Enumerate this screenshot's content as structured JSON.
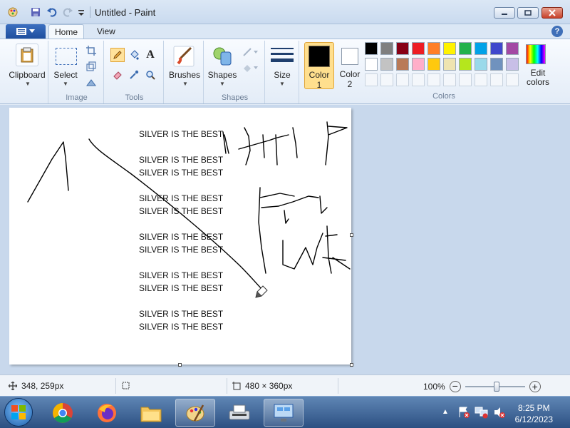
{
  "window": {
    "title": "Untitled - Paint"
  },
  "tabs": [
    {
      "label": "Home",
      "active": true
    },
    {
      "label": "View",
      "active": false
    }
  ],
  "ribbon": {
    "clipboard": {
      "label": "Clipboard"
    },
    "image": {
      "group_label": "Image",
      "select_label": "Select"
    },
    "tools": {
      "group_label": "Tools"
    },
    "brushes": {
      "label": "Brushes"
    },
    "shapes": {
      "label": "Shapes",
      "group_label": "Shapes"
    },
    "size": {
      "label": "Size"
    },
    "color1": {
      "label": "Color",
      "num": "1",
      "value": "#000000"
    },
    "color2": {
      "label": "Color",
      "num": "2",
      "value": "#ffffff"
    },
    "colors_group_label": "Colors",
    "edit_colors_label": "Edit colors",
    "palette_row1": [
      "#000000",
      "#7f7f7f",
      "#880015",
      "#ed1c24",
      "#ff7f27",
      "#fff200",
      "#22b14c",
      "#00a2e8",
      "#3f48cc",
      "#a349a4"
    ],
    "palette_row2": [
      "#ffffff",
      "#c3c3c3",
      "#b97a57",
      "#ffaec9",
      "#ffc90e",
      "#efe4b0",
      "#b5e61d",
      "#99d9ea",
      "#7092be",
      "#c8bfe7"
    ]
  },
  "canvas": {
    "lines": [
      "SILVER IS THE BEST",
      "SILVER IS THE BEST",
      "SILVER IS THE BEST",
      "SILVER IS THE BEST",
      "SILVER IS THE BEST",
      "SILVER IS THE BEST",
      "SILVER IS THE BEST",
      "SILVER IS THE BEST",
      "SILVER IS THE BEST",
      "SILVER IS THE BEST",
      "SILVER IS THE BEST"
    ]
  },
  "status": {
    "cursor_pos": "348, 259px",
    "canvas_size": "480 × 360px",
    "zoom": "100%"
  },
  "taskbar": {
    "time": "8:25 PM",
    "date": "6/12/2023"
  }
}
